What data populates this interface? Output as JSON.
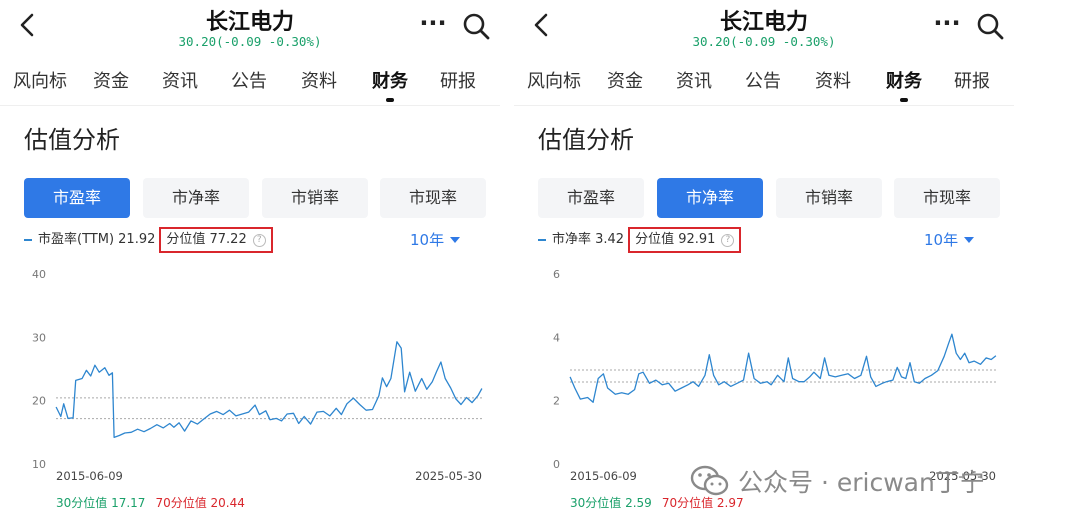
{
  "panels": [
    {
      "header": {
        "title": "长江电力",
        "quote": "30.20(-0.09 -0.30%)",
        "more": "···"
      },
      "tabs": [
        {
          "label": "风向标",
          "active": false
        },
        {
          "label": "资金",
          "active": false
        },
        {
          "label": "资讯",
          "active": false
        },
        {
          "label": "公告",
          "active": false
        },
        {
          "label": "资料",
          "active": false
        },
        {
          "label": "财务",
          "active": true
        },
        {
          "label": "研报",
          "active": false
        }
      ],
      "section_title": "估值分析",
      "metric_tabs": [
        {
          "label": "市盈率",
          "active": true
        },
        {
          "label": "市净率",
          "active": false
        },
        {
          "label": "市销率",
          "active": false
        },
        {
          "label": "市现率",
          "active": false
        }
      ],
      "legend": {
        "label": "市盈率(TTM) 21.92",
        "percentile": "分位值 77.22",
        "help": "?"
      },
      "range": "10年",
      "footer": {
        "p30": "30分位值 17.17",
        "p70": "70分位值 20.44"
      }
    },
    {
      "header": {
        "title": "长江电力",
        "quote": "30.20(-0.09 -0.30%)",
        "more": "···"
      },
      "tabs": [
        {
          "label": "风向标",
          "active": false
        },
        {
          "label": "资金",
          "active": false
        },
        {
          "label": "资讯",
          "active": false
        },
        {
          "label": "公告",
          "active": false
        },
        {
          "label": "资料",
          "active": false
        },
        {
          "label": "财务",
          "active": true
        },
        {
          "label": "研报",
          "active": false
        }
      ],
      "section_title": "估值分析",
      "metric_tabs": [
        {
          "label": "市盈率",
          "active": false
        },
        {
          "label": "市净率",
          "active": true
        },
        {
          "label": "市销率",
          "active": false
        },
        {
          "label": "市现率",
          "active": false
        }
      ],
      "legend": {
        "label": "市净率 3.42",
        "percentile": "分位值 92.91",
        "help": "?"
      },
      "range": "10年",
      "footer": {
        "p30": "30分位值 2.59",
        "p70": "70分位值 2.97"
      }
    }
  ],
  "watermark": "公众号 · ericwan丁宁",
  "colors": {
    "accent": "#2f79e6",
    "line": "#2e86cf",
    "up": "#1aa06a",
    "down": "#d9262c",
    "highlight": "#d9262c"
  },
  "chart_data": [
    {
      "type": "line",
      "title": "",
      "xlabel": "",
      "ylabel": "",
      "ylim": [
        10,
        40
      ],
      "yticks": [
        "40",
        "30",
        "20",
        "10"
      ],
      "x_labels": [
        "2015-06-09",
        "2025-05-30"
      ],
      "x_range": [
        "2015-06-09",
        "2025-05-30"
      ],
      "reference_lines": [
        17.17,
        20.44
      ],
      "series": [
        {
          "values": [
            [
              2015.44,
              19.0
            ],
            [
              2015.55,
              17.5
            ],
            [
              2015.62,
              19.5
            ],
            [
              2015.72,
              17.2
            ],
            [
              2015.84,
              17.3
            ],
            [
              2015.9,
              23.2
            ],
            [
              2016.05,
              23.5
            ],
            [
              2016.15,
              24.8
            ],
            [
              2016.25,
              23.9
            ],
            [
              2016.35,
              25.6
            ],
            [
              2016.45,
              24.5
            ],
            [
              2016.58,
              25.2
            ],
            [
              2016.68,
              24.0
            ],
            [
              2016.76,
              24.4
            ],
            [
              2016.8,
              14.2
            ],
            [
              2016.92,
              14.5
            ],
            [
              2017.05,
              14.9
            ],
            [
              2017.2,
              15.0
            ],
            [
              2017.35,
              15.5
            ],
            [
              2017.5,
              15.1
            ],
            [
              2017.65,
              15.6
            ],
            [
              2017.8,
              16.2
            ],
            [
              2017.95,
              15.7
            ],
            [
              2018.1,
              16.4
            ],
            [
              2018.2,
              15.8
            ],
            [
              2018.32,
              16.5
            ],
            [
              2018.45,
              15.2
            ],
            [
              2018.6,
              16.8
            ],
            [
              2018.75,
              16.3
            ],
            [
              2018.9,
              17.1
            ],
            [
              2019.05,
              17.9
            ],
            [
              2019.2,
              18.3
            ],
            [
              2019.35,
              17.8
            ],
            [
              2019.5,
              18.5
            ],
            [
              2019.65,
              17.6
            ],
            [
              2019.8,
              17.9
            ],
            [
              2019.95,
              18.2
            ],
            [
              2020.1,
              19.3
            ],
            [
              2020.2,
              17.8
            ],
            [
              2020.35,
              18.4
            ],
            [
              2020.45,
              17.0
            ],
            [
              2020.6,
              17.2
            ],
            [
              2020.72,
              16.8
            ],
            [
              2020.85,
              17.9
            ],
            [
              2021.0,
              18.0
            ],
            [
              2021.12,
              16.4
            ],
            [
              2021.25,
              17.5
            ],
            [
              2021.4,
              16.3
            ],
            [
              2021.55,
              18.2
            ],
            [
              2021.7,
              18.3
            ],
            [
              2021.85,
              17.6
            ],
            [
              2022.0,
              18.8
            ],
            [
              2022.12,
              17.8
            ],
            [
              2022.25,
              19.5
            ],
            [
              2022.4,
              20.4
            ],
            [
              2022.55,
              19.4
            ],
            [
              2022.7,
              18.5
            ],
            [
              2022.85,
              18.6
            ],
            [
              2023.0,
              20.8
            ],
            [
              2023.08,
              23.6
            ],
            [
              2023.18,
              22.2
            ],
            [
              2023.28,
              23.5
            ],
            [
              2023.42,
              29.3
            ],
            [
              2023.52,
              28.3
            ],
            [
              2023.6,
              21.4
            ],
            [
              2023.72,
              24.5
            ],
            [
              2023.85,
              21.5
            ],
            [
              2024.0,
              23.5
            ],
            [
              2024.12,
              21.8
            ],
            [
              2024.25,
              23.0
            ],
            [
              2024.35,
              24.6
            ],
            [
              2024.45,
              26.1
            ],
            [
              2024.55,
              23.5
            ],
            [
              2024.68,
              22.0
            ],
            [
              2024.8,
              20.3
            ],
            [
              2024.92,
              19.4
            ],
            [
              2025.05,
              20.5
            ],
            [
              2025.18,
              19.7
            ],
            [
              2025.32,
              20.8
            ],
            [
              2025.41,
              21.92
            ]
          ]
        }
      ]
    },
    {
      "type": "line",
      "title": "",
      "xlabel": "",
      "ylabel": "",
      "ylim": [
        0,
        6
      ],
      "yticks": [
        "6",
        "4",
        "2",
        "0"
      ],
      "x_labels": [
        "2015-06-09",
        "2025-05-30"
      ],
      "x_range": [
        "2015-06-09",
        "2025-05-30"
      ],
      "reference_lines": [
        2.59,
        2.97
      ],
      "series": [
        {
          "values": [
            [
              2015.44,
              2.75
            ],
            [
              2015.55,
              2.4
            ],
            [
              2015.68,
              2.05
            ],
            [
              2015.85,
              2.1
            ],
            [
              2015.98,
              1.95
            ],
            [
              2016.1,
              2.7
            ],
            [
              2016.22,
              2.85
            ],
            [
              2016.32,
              2.4
            ],
            [
              2016.5,
              2.2
            ],
            [
              2016.65,
              2.25
            ],
            [
              2016.8,
              2.2
            ],
            [
              2016.95,
              2.35
            ],
            [
              2017.05,
              2.85
            ],
            [
              2017.15,
              2.9
            ],
            [
              2017.3,
              2.55
            ],
            [
              2017.45,
              2.65
            ],
            [
              2017.6,
              2.5
            ],
            [
              2017.75,
              2.55
            ],
            [
              2017.9,
              2.3
            ],
            [
              2018.05,
              2.4
            ],
            [
              2018.2,
              2.5
            ],
            [
              2018.32,
              2.6
            ],
            [
              2018.45,
              2.45
            ],
            [
              2018.6,
              2.8
            ],
            [
              2018.7,
              3.45
            ],
            [
              2018.8,
              2.8
            ],
            [
              2018.92,
              2.5
            ],
            [
              2019.05,
              2.6
            ],
            [
              2019.2,
              2.45
            ],
            [
              2019.35,
              2.55
            ],
            [
              2019.5,
              2.65
            ],
            [
              2019.62,
              3.5
            ],
            [
              2019.75,
              2.7
            ],
            [
              2019.9,
              2.55
            ],
            [
              2020.05,
              2.6
            ],
            [
              2020.15,
              2.5
            ],
            [
              2020.3,
              2.8
            ],
            [
              2020.45,
              2.6
            ],
            [
              2020.55,
              3.35
            ],
            [
              2020.65,
              2.7
            ],
            [
              2020.8,
              2.6
            ],
            [
              2020.92,
              2.6
            ],
            [
              2021.05,
              2.75
            ],
            [
              2021.15,
              2.9
            ],
            [
              2021.3,
              2.7
            ],
            [
              2021.4,
              3.35
            ],
            [
              2021.5,
              2.8
            ],
            [
              2021.65,
              2.75
            ],
            [
              2021.8,
              2.8
            ],
            [
              2021.95,
              2.85
            ],
            [
              2022.1,
              2.7
            ],
            [
              2022.25,
              2.8
            ],
            [
              2022.38,
              3.4
            ],
            [
              2022.48,
              2.75
            ],
            [
              2022.6,
              2.45
            ],
            [
              2022.75,
              2.55
            ],
            [
              2022.85,
              2.6
            ],
            [
              2023.0,
              2.65
            ],
            [
              2023.1,
              3.05
            ],
            [
              2023.2,
              2.75
            ],
            [
              2023.3,
              2.7
            ],
            [
              2023.4,
              3.2
            ],
            [
              2023.5,
              2.6
            ],
            [
              2023.62,
              2.55
            ],
            [
              2023.75,
              2.7
            ],
            [
              2023.9,
              2.8
            ],
            [
              2024.05,
              2.95
            ],
            [
              2024.2,
              3.4
            ],
            [
              2024.3,
              3.8
            ],
            [
              2024.38,
              4.1
            ],
            [
              2024.48,
              3.5
            ],
            [
              2024.58,
              3.3
            ],
            [
              2024.68,
              3.5
            ],
            [
              2024.78,
              3.2
            ],
            [
              2024.9,
              3.25
            ],
            [
              2025.05,
              3.15
            ],
            [
              2025.18,
              3.35
            ],
            [
              2025.3,
              3.3
            ],
            [
              2025.41,
              3.42
            ]
          ]
        }
      ]
    }
  ]
}
